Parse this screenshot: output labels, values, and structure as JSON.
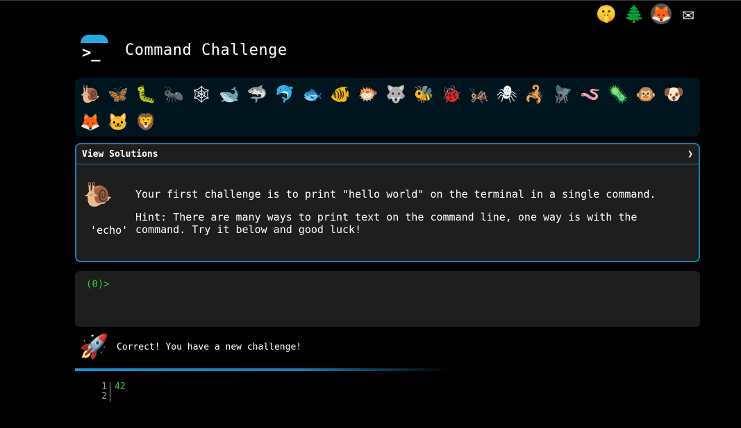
{
  "app": {
    "title": "Command Challenge"
  },
  "top_icons": [
    {
      "name": "terminal-icon",
      "glyph": ">_"
    },
    {
      "name": "shush-face-icon",
      "glyph": "🤫"
    },
    {
      "name": "tree-icon",
      "glyph": "🌲"
    },
    {
      "name": "gitlab-icon",
      "glyph": "🦊"
    },
    {
      "name": "mail-icon",
      "glyph": "✉"
    }
  ],
  "animals": [
    {
      "name": "snail",
      "glyph": "🐌"
    },
    {
      "name": "butterfly",
      "glyph": "🦋"
    },
    {
      "name": "caterpillar",
      "glyph": "🐛"
    },
    {
      "name": "ant",
      "glyph": "🐜"
    },
    {
      "name": "spider-web",
      "glyph": "🕸"
    },
    {
      "name": "whale",
      "glyph": "🐋"
    },
    {
      "name": "shark",
      "glyph": "🦈"
    },
    {
      "name": "dolphin",
      "glyph": "🐬"
    },
    {
      "name": "fish",
      "glyph": "🐟"
    },
    {
      "name": "tropical-fish",
      "glyph": "🐠"
    },
    {
      "name": "blowfish",
      "glyph": "🐡"
    },
    {
      "name": "wolf",
      "glyph": "🐺"
    },
    {
      "name": "bee",
      "glyph": "🐝"
    },
    {
      "name": "lady-beetle",
      "glyph": "🐞"
    },
    {
      "name": "cricket",
      "glyph": "🦗"
    },
    {
      "name": "spider",
      "glyph": "🕷"
    },
    {
      "name": "scorpion",
      "glyph": "🦂"
    },
    {
      "name": "fly",
      "glyph": "🪰"
    },
    {
      "name": "worm",
      "glyph": "🪱"
    },
    {
      "name": "microbe",
      "glyph": "🦠"
    },
    {
      "name": "monkey",
      "glyph": "🐵"
    },
    {
      "name": "dog",
      "glyph": "🐶"
    },
    {
      "name": "fox",
      "glyph": "🦊"
    },
    {
      "name": "cat",
      "glyph": "🐱"
    },
    {
      "name": "lion",
      "glyph": "🦁"
    }
  ],
  "panel": {
    "header": "View Solutions",
    "chevron": "❯",
    "snail_glyph": "🐌",
    "line1": "Your first challenge is to print \"hello world\" on the terminal in a single command.",
    "line2": "Hint: There are many ways to print text on the command line, one way is with the",
    "echo": "'echo'",
    "line3": "command. Try it below and good luck!"
  },
  "terminal": {
    "prompt": "(0)>"
  },
  "feedback": {
    "rocket_glyph": "🚀",
    "text": "Correct! You have a new challenge!"
  },
  "output": {
    "line_numbers": [
      "1",
      "2"
    ],
    "lines": [
      "42",
      ""
    ]
  },
  "colors": {
    "accent": "#1c7fb0",
    "prompt": "#2ecc40",
    "panel_bg": "#1e1e1e",
    "animal_bar_bg": "#00141e"
  }
}
